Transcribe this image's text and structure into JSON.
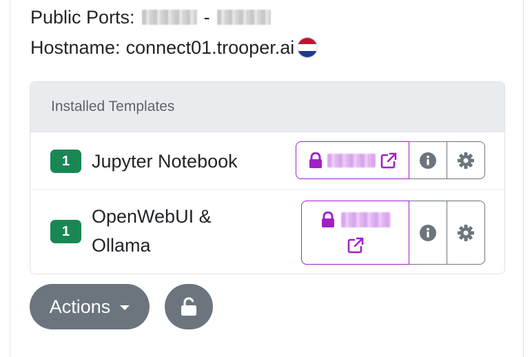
{
  "info": {
    "ports_label": "Public Ports:",
    "ports_separator": "-",
    "hostname_label": "Hostname:",
    "hostname_value": "connect01.trooper.ai",
    "flag_icon": "netherlands-flag-icon"
  },
  "templates": {
    "header": "Installed Templates",
    "rows": [
      {
        "count": "1",
        "name": "Jupyter Notebook"
      },
      {
        "count": "1",
        "name_line1": "OpenWebUI &",
        "name_line2": "Ollama"
      }
    ]
  },
  "footer": {
    "actions_label": "Actions"
  },
  "colors": {
    "accent_purple": "#a020c8",
    "badge_green": "#198754",
    "button_gray": "#6c757d",
    "header_bg": "#e9ecef"
  },
  "icons": [
    "lock-icon",
    "external-link-icon",
    "info-icon",
    "gear-icon",
    "caret-down-icon",
    "unlock-icon"
  ]
}
